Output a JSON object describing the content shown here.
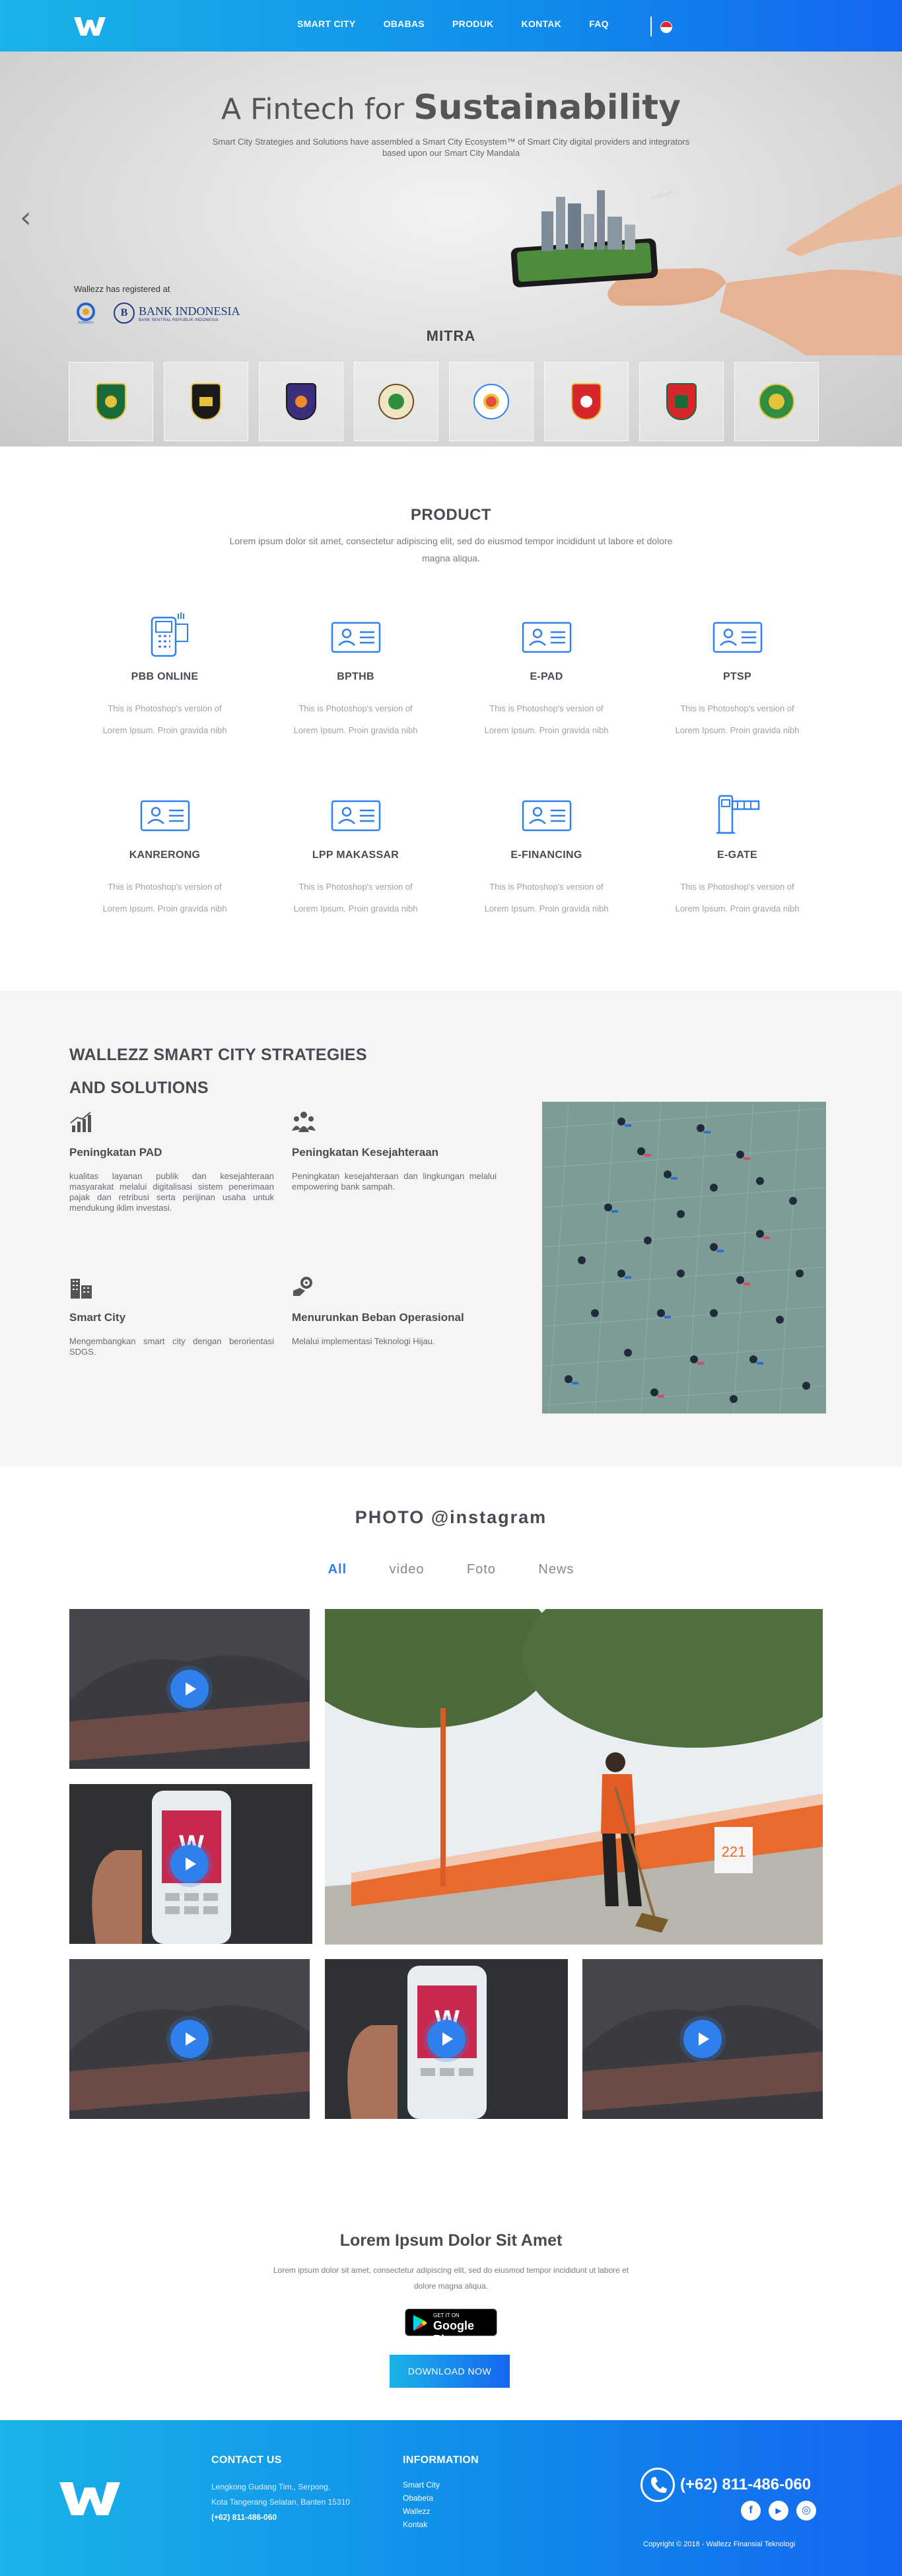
{
  "nav": {
    "links": [
      "SMART CITY",
      "OBABAS",
      "PRODUK",
      "KONTAK",
      "FAQ"
    ]
  },
  "hero": {
    "title_prefix": "A Fintech for",
    "title_main": "Sustainability",
    "subtitle": "Smart City Strategies and Solutions have assembled a Smart City Ecosystem™ of Smart City digital providers and integrators based upon our Smart City Mandala",
    "registered_text": "Wallezz has registered at",
    "bi_name": "BANK INDONESIA",
    "bi_tagline": "BANK SENTRAL REPUBLIK INDONESIA",
    "kominfo_label": "KOMINFO",
    "mitra_title": "MITRA"
  },
  "product": {
    "title": "PRODUCT",
    "subtitle": "Lorem ipsum dolor sit amet, consectetur adipiscing elit, sed do eiusmod tempor incididunt ut labore et dolore magna aliqua.",
    "items": [
      {
        "name": "PBB ONLINE",
        "desc1": "This is Photoshop's version  of",
        "desc2": "Lorem Ipsum. Proin gravida nibh",
        "icon": "pos-terminal-icon"
      },
      {
        "name": "BPTHB",
        "desc1": "This is Photoshop's version  of",
        "desc2": "Lorem Ipsum. Proin gravida nibh",
        "icon": "id-card-icon"
      },
      {
        "name": "E-PAD",
        "desc1": "This is Photoshop's version  of",
        "desc2": "Lorem Ipsum. Proin gravida nibh",
        "icon": "id-card-icon"
      },
      {
        "name": "PTSP",
        "desc1": "This is Photoshop's version  of",
        "desc2": "Lorem Ipsum. Proin gravida nibh",
        "icon": "id-card-icon"
      },
      {
        "name": "KANRERONG",
        "desc1": "This is Photoshop's version  of",
        "desc2": "Lorem Ipsum. Proin gravida nibh",
        "icon": "id-card-icon"
      },
      {
        "name": "LPP MAKASSAR",
        "desc1": "This is Photoshop's version  of",
        "desc2": "Lorem Ipsum. Proin gravida nibh",
        "icon": "id-card-icon"
      },
      {
        "name": "E-FINANCING",
        "desc1": "This is Photoshop's version  of",
        "desc2": "Lorem Ipsum. Proin gravida nibh",
        "icon": "id-card-icon"
      },
      {
        "name": "E-GATE",
        "desc1": "This is Photoshop's version  of",
        "desc2": "Lorem Ipsum. Proin gravida nibh",
        "icon": "gate-icon"
      }
    ]
  },
  "strategies": {
    "title_line1": "WALLEZZ SMART CITY STRATEGIES",
    "title_line2": "AND SOLUTIONS",
    "features": [
      {
        "name": "Peningkatan PAD",
        "desc": "kualitas layanan publik dan kesejahteraan masyarakat melalui digitalisasi sistem penerimaan pajak dan retribusi serta perijinan usaha untuk mendukung iklim investasi.",
        "icon": "growth-chart-icon"
      },
      {
        "name": "Peningkatan Kesejahteraan",
        "desc": "Peningkatan kesejahteraan dan lingkungan melalui empowering bank sampah.",
        "icon": "community-icon"
      },
      {
        "name": "Smart City",
        "desc": "Mengembangkan smart city dengan berorientasi SDGS.",
        "icon": "city-buildings-icon"
      },
      {
        "name": "Menurunkan Beban Operasional",
        "desc": "Melalui implementasi Teknologi Hijau.",
        "icon": "gear-hand-icon"
      }
    ]
  },
  "instagram": {
    "title": "PHOTO @instagram",
    "tabs": [
      "All",
      "video",
      "Foto",
      "News"
    ],
    "active_tab": "All"
  },
  "cta": {
    "title": "Lorem Ipsum Dolor Sit Amet",
    "subtitle": "Lorem ipsum dolor sit amet, consectetur adipiscing elit, sed do eiusmod tempor incididunt ut labore et dolore magna aliqua.",
    "gplay_small": "GET IT ON",
    "gplay_big": "Google Play",
    "download_label": "DOWNLOAD NOW"
  },
  "footer": {
    "contact_title": "CONTACT US",
    "address_line1": "Lengkong Gudang Tim., Serpong,",
    "address_line2": "Kota Tangerang Selatan, Banten 15310",
    "phone_small": "(+62) 811-486-060",
    "info_title": "INFORMATION",
    "info_links": [
      "Smart City",
      "Obabeta",
      "Wallezz",
      "Kontak"
    ],
    "phone_big": "(+62) 811-486-060",
    "copyright": "Copyright © 2018 - Wallezz Finansial Teknologi",
    "social": [
      "f",
      "▶",
      "◎"
    ]
  },
  "colors": {
    "brand_start": "#1bb2e8",
    "brand_end": "#1466f0",
    "accent_blue": "#2f80ed"
  }
}
